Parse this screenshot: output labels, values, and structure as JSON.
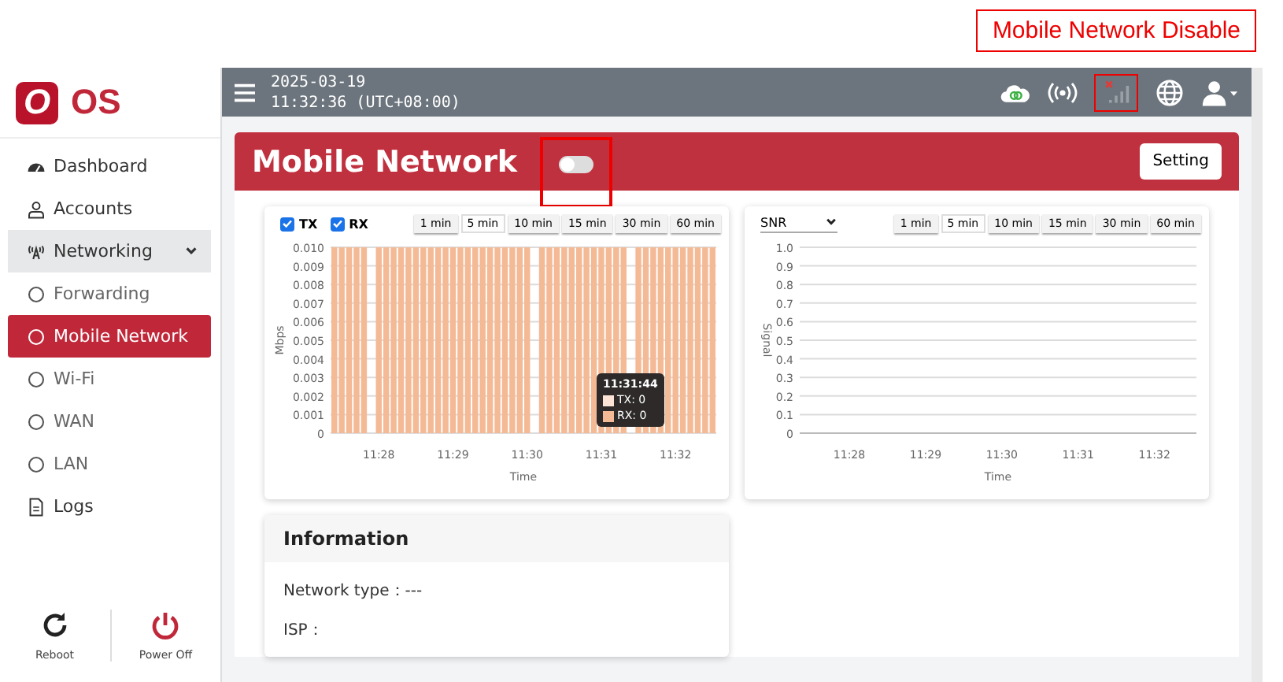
{
  "annotation": {
    "label": "Mobile Network Disable"
  },
  "brand": {
    "logo_letter": "O",
    "name": "OS"
  },
  "sidebar": {
    "items": [
      {
        "kind": "dashboard",
        "label": "Dashboard",
        "selected": false
      },
      {
        "kind": "accounts",
        "label": "Accounts",
        "selected": false
      },
      {
        "kind": "group",
        "label": "Networking",
        "expanded": true,
        "selected": false,
        "children": [
          {
            "label": "Forwarding",
            "selected": false
          },
          {
            "label": "Mobile Network",
            "selected": true
          },
          {
            "label": "Wi-Fi",
            "selected": false
          },
          {
            "label": "WAN",
            "selected": false
          },
          {
            "label": "LAN",
            "selected": false
          }
        ]
      },
      {
        "kind": "logs",
        "label": "Logs",
        "selected": false
      }
    ],
    "actions": [
      {
        "kind": "reboot",
        "label": "Reboot"
      },
      {
        "kind": "power",
        "label": "Power Off"
      }
    ]
  },
  "topbar": {
    "date": "2025-03-19",
    "time": "11:32:36 (UTC+08:00)"
  },
  "header": {
    "title": "Mobile Network",
    "toggle_on": false,
    "button": "Setting"
  },
  "traffic_card": {
    "checks": [
      {
        "label": "TX",
        "checked": true
      },
      {
        "label": "RX",
        "checked": true
      }
    ],
    "ranges": [
      {
        "label": "1 min",
        "selected": false
      },
      {
        "label": "5 min",
        "selected": true
      },
      {
        "label": "10 min",
        "selected": false
      },
      {
        "label": "15 min",
        "selected": false
      },
      {
        "label": "30 min",
        "selected": false
      },
      {
        "label": "60 min",
        "selected": false
      }
    ],
    "tooltip": {
      "title": "11:31:44",
      "lines": [
        "TX: 0",
        "RX: 0"
      ]
    },
    "chart_data": {
      "type": "bar",
      "xlabel": "Time",
      "ylabel": "Mbps",
      "grid": true,
      "ylim": [
        0,
        0.01
      ],
      "yticks": [
        0,
        {
          "value": 0.001,
          "label": "0.001"
        },
        {
          "value": 0.002,
          "label": "0.002"
        },
        {
          "value": 0.003,
          "label": "0.003"
        },
        {
          "value": 0.004,
          "label": "0.004"
        },
        {
          "value": 0.005,
          "label": "0.005"
        },
        {
          "value": 0.006,
          "label": "0.006"
        },
        {
          "value": 0.007,
          "label": "0.007"
        },
        {
          "value": 0.008,
          "label": "0.008"
        },
        {
          "value": 0.009,
          "label": "0.009"
        },
        {
          "value": 0.01,
          "label": "0.010"
        }
      ],
      "categories": [
        null,
        null,
        null,
        null,
        null,
        null,
        "11:28",
        null,
        null,
        null,
        null,
        null,
        null,
        null,
        null,
        null,
        "11:29",
        null,
        null,
        null,
        null,
        null,
        null,
        null,
        null,
        null,
        "11:30",
        null,
        null,
        null,
        null,
        null,
        null,
        null,
        null,
        null,
        "11:31",
        null,
        null,
        null,
        null,
        null,
        null,
        null,
        null,
        null,
        "11:32",
        null,
        null,
        null,
        null,
        null
      ],
      "series": [
        {
          "color": "#f4b995",
          "values": [
            0.01,
            0.01,
            0.01,
            0.01,
            0.01,
            null,
            0.01,
            0.01,
            0.01,
            0.01,
            0.01,
            0.01,
            0.01,
            0.01,
            0.01,
            0.01,
            0.01,
            0.01,
            0.01,
            0.01,
            0.01,
            0.01,
            0.01,
            0.01,
            0.01,
            0.01,
            0.01,
            null,
            0.01,
            0.01,
            0.01,
            0.01,
            0.01,
            0.01,
            0.01,
            0.01,
            0.01,
            0.01,
            0.01,
            0.01,
            null,
            0.01,
            0.01,
            0.01,
            0.01,
            0.01,
            0.01,
            0.01,
            0.01,
            0.01,
            0.01,
            0.01
          ]
        }
      ]
    }
  },
  "signal_card": {
    "select": "SNR",
    "ranges": [
      {
        "label": "1 min",
        "selected": false
      },
      {
        "label": "5 min",
        "selected": true
      },
      {
        "label": "10 min",
        "selected": false
      },
      {
        "label": "15 min",
        "selected": false
      },
      {
        "label": "30 min",
        "selected": false
      },
      {
        "label": "60 min",
        "selected": false
      }
    ],
    "chart_data": {
      "type": "line",
      "xlabel": "Time",
      "ylabel": "Signal",
      "grid": true,
      "ylim": [
        0,
        1
      ],
      "yticks": [
        0,
        {
          "value": 0.1,
          "label": "0.1"
        },
        {
          "value": 0.2,
          "label": "0.2"
        },
        {
          "value": 0.3,
          "label": "0.3"
        },
        {
          "value": 0.4,
          "label": "0.4"
        },
        {
          "value": 0.5,
          "label": "0.5"
        },
        {
          "value": 0.6,
          "label": "0.6"
        },
        {
          "value": 0.7,
          "label": "0.7"
        },
        {
          "value": 0.8,
          "label": "0.8"
        },
        {
          "value": 0.9,
          "label": "0.9"
        },
        {
          "value": 1,
          "label": "1.0"
        }
      ],
      "categories": [
        null,
        null,
        null,
        null,
        null,
        null,
        "11:28",
        null,
        null,
        null,
        null,
        null,
        null,
        null,
        null,
        null,
        "11:29",
        null,
        null,
        null,
        null,
        null,
        null,
        null,
        null,
        null,
        "11:30",
        null,
        null,
        null,
        null,
        null,
        null,
        null,
        null,
        null,
        "11:31",
        null,
        null,
        null,
        null,
        null,
        null,
        null,
        null,
        null,
        "11:32",
        null,
        null,
        null,
        null,
        null
      ]
    }
  },
  "info_card": {
    "title": "Information",
    "rows": [
      {
        "label": "Network type：",
        "value": "---"
      },
      {
        "label": "ISP："
      }
    ]
  }
}
